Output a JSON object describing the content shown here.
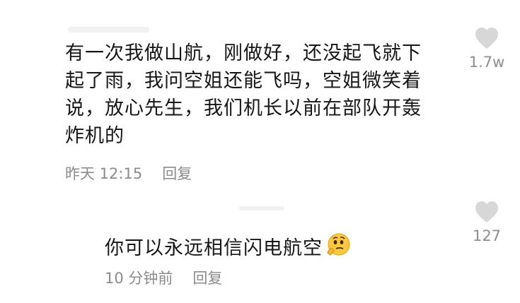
{
  "comment": {
    "lines": [
      "有一次我做山航，刚做好，还没起飞就下",
      "起了雨，我问空姐还能飞吗，空姐微笑着",
      "说，放心先生，我们机长以前在部队开轰",
      "炸机的"
    ],
    "time": "昨天 12:15",
    "reply_label": "回复",
    "like_count": "1.7w"
  },
  "sub_reply": {
    "text": "你可以永远相信闪电航空",
    "emoji": "thinking-face-emoji",
    "time": "10 分钟前",
    "reply_label": "回复",
    "like_count": "127"
  },
  "icons": {
    "like": "heart-icon"
  },
  "colors": {
    "text": "#161616",
    "meta": "#8b8b8b",
    "heart": "#d7d7d7"
  }
}
